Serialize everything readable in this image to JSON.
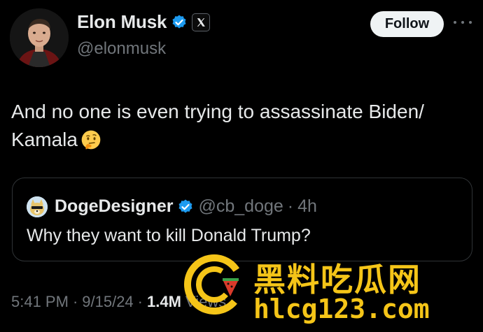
{
  "author": {
    "name": "Elon Musk",
    "handle": "@elonmusk",
    "avatar_icon": "elon-avatar",
    "verified_color": "#1d9bf0"
  },
  "follow_label": "Follow",
  "tweet": {
    "text": "And no one is even trying to assassinate Biden/\nKamala",
    "emoji_icon": "thinking-face-icon"
  },
  "quote": {
    "name": "DogeDesigner",
    "handle": "@cb_doge",
    "dot": "·",
    "time": "4h",
    "text": "Why they want to kill Donald Trump?"
  },
  "meta": {
    "time": "5:41 PM",
    "sep1": "·",
    "date": "9/15/24",
    "sep2": "·",
    "views_count": "1.4M",
    "views_label": "Views"
  },
  "watermark": {
    "chinese": "黑料吃瓜网",
    "url": "hlcg123.com",
    "color": "#f5c518"
  }
}
